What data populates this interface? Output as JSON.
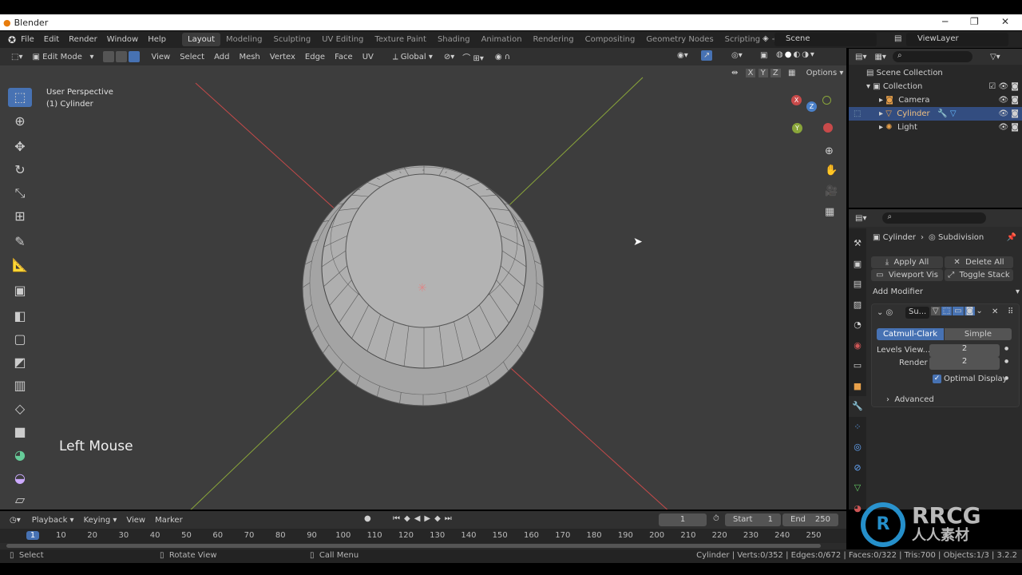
{
  "window": {
    "title": "Blender",
    "minimize": "─",
    "maximize": "❐",
    "close": "✕"
  },
  "menu": {
    "items": [
      "File",
      "Edit",
      "Render",
      "Window",
      "Help"
    ],
    "workspaces": [
      "Layout",
      "Modeling",
      "Sculpting",
      "UV Editing",
      "Texture Paint",
      "Shading",
      "Animation",
      "Rendering",
      "Compositing",
      "Geometry Nodes",
      "Scripting"
    ],
    "add_tab": "+",
    "scene": "Scene",
    "view_layer": "ViewLayer"
  },
  "header": {
    "mode": "Edit Mode",
    "menus": [
      "View",
      "Select",
      "Add",
      "Mesh",
      "Vertex",
      "Edge",
      "Face",
      "UV"
    ],
    "orientation": "Global",
    "options": "Options",
    "axes": [
      "X",
      "Y",
      "Z"
    ]
  },
  "viewport": {
    "perspective": "User Perspective",
    "object": "(1) Cylinder",
    "overlay_text": "Left Mouse",
    "gizmo": {
      "x": "X",
      "y": "Y",
      "z": "Z"
    }
  },
  "outliner": {
    "root": "Scene Collection",
    "collection": "Collection",
    "items": [
      {
        "name": "Camera",
        "selected": false
      },
      {
        "name": "Cylinder",
        "selected": true
      },
      {
        "name": "Light",
        "selected": false
      }
    ]
  },
  "properties": {
    "breadcrumb_object": "Cylinder",
    "breadcrumb_modifier": "Subdivision",
    "apply_all": "Apply All",
    "delete_all": "Delete All",
    "viewport_vis": "Viewport Vis",
    "toggle_stack": "Toggle Stack",
    "add_modifier": "Add Modifier",
    "modifier_name": "Su...",
    "catmull": "Catmull-Clark",
    "simple": "Simple",
    "levels_label": "Levels View...",
    "levels_value": "2",
    "render_label": "Render",
    "render_value": "2",
    "optimal_display": "Optimal Display",
    "optimal_checked": true,
    "advanced": "Advanced"
  },
  "timeline": {
    "menus": [
      "Playback",
      "Keying",
      "View",
      "Marker"
    ],
    "current_frame": "1",
    "start_label": "Start",
    "start": "1",
    "end_label": "End",
    "end": "250",
    "ticks": [
      "1",
      "10",
      "20",
      "30",
      "40",
      "50",
      "60",
      "70",
      "80",
      "90",
      "100",
      "110",
      "120",
      "130",
      "140",
      "150",
      "160",
      "170",
      "180",
      "190",
      "200",
      "210",
      "220",
      "230",
      "240",
      "250"
    ]
  },
  "status": {
    "select": "Select",
    "rotate": "Rotate View",
    "call_menu": "Call Menu",
    "stats": "Cylinder | Verts:0/352 | Edges:0/672 | Faces:0/322 | Tris:700 | Objects:1/3 | 3.2.2"
  },
  "watermark": {
    "brand": "RRCG",
    "cn": "人人素材"
  },
  "colors": {
    "accent": "#4772b3",
    "viewport": "#3d3d3d",
    "x_axis": "#c84a4a",
    "y_axis": "#8aa63a"
  }
}
